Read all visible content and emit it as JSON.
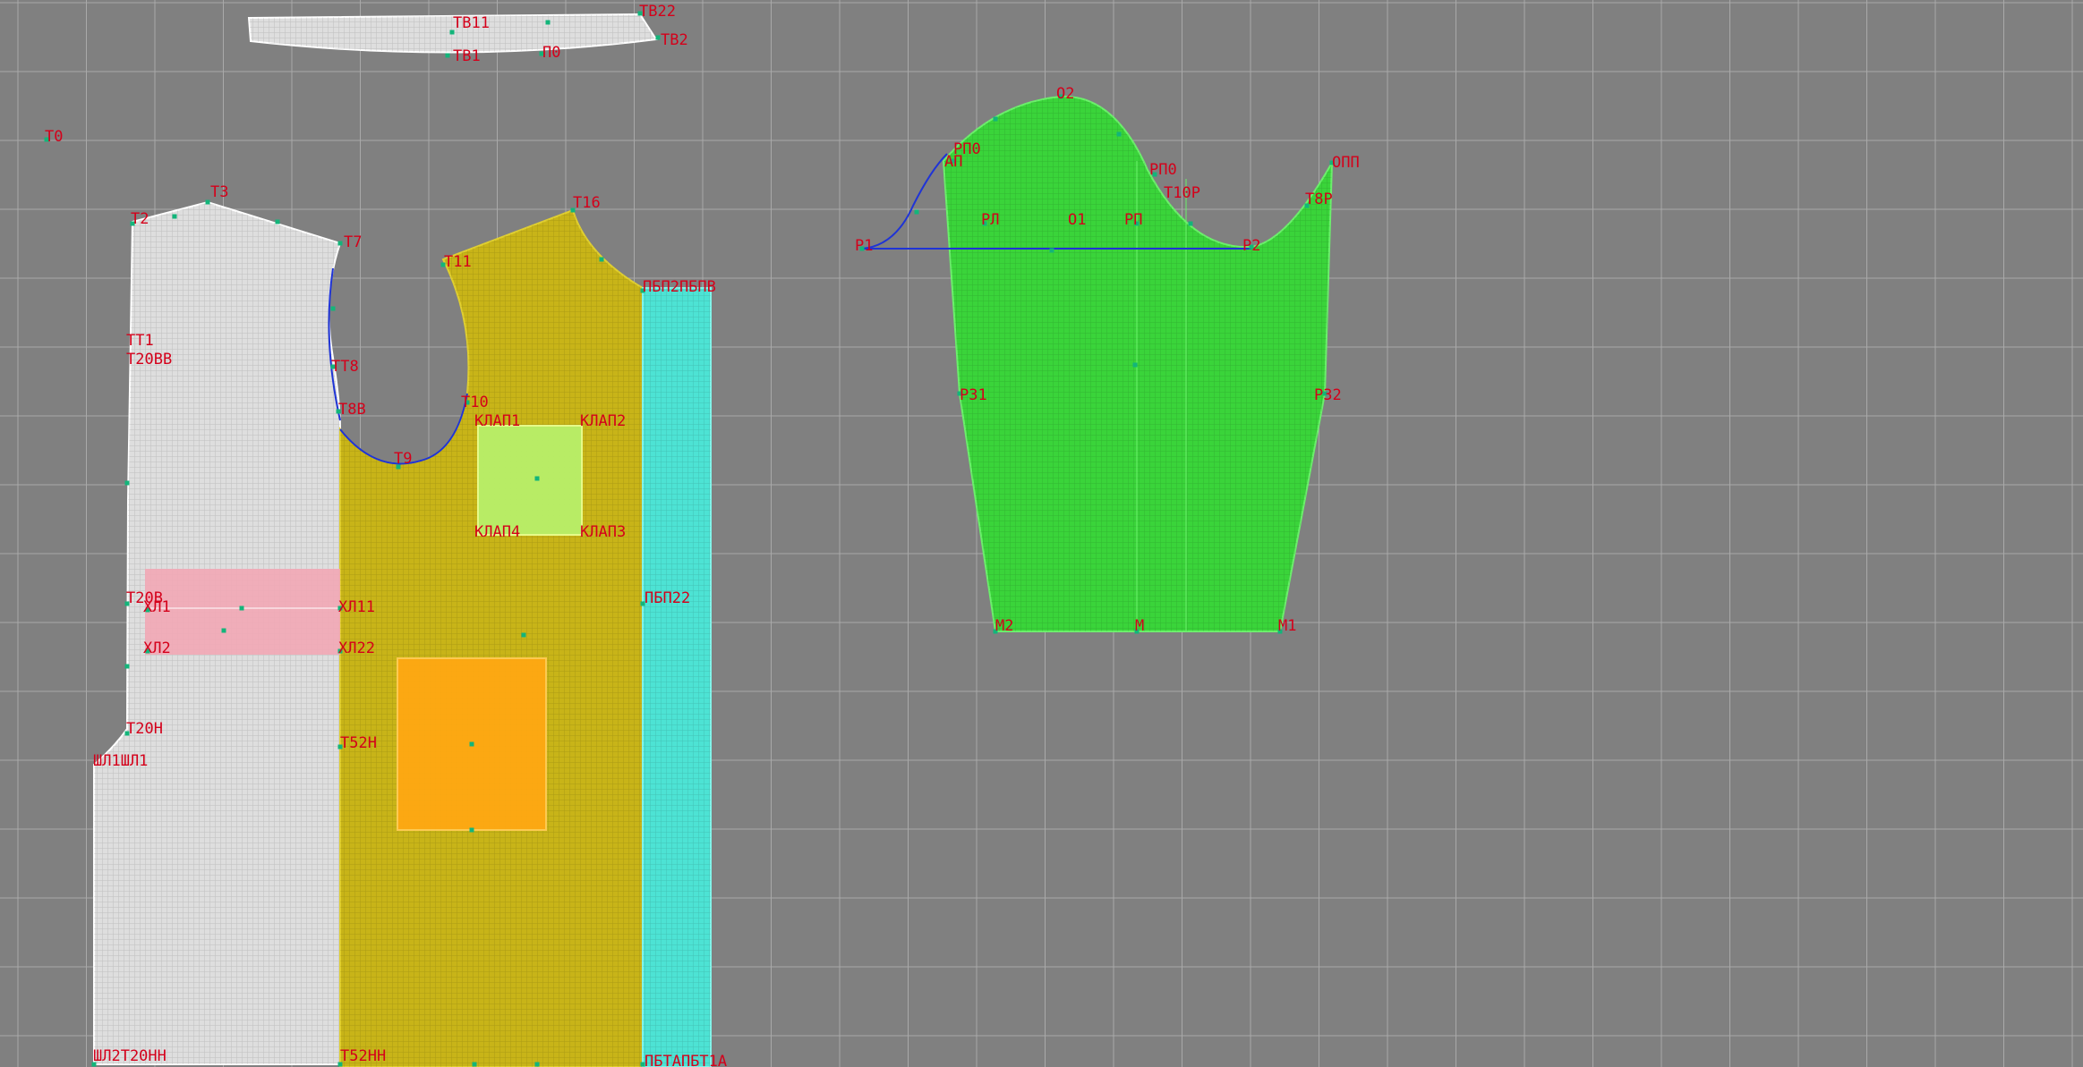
{
  "colors": {
    "background": "#808080",
    "grid": "#a9a9a9",
    "back_piece": "#dedede",
    "front_piece": "#c8b418",
    "placket": "#4de3d4",
    "sleeve": "#3ad43a",
    "pocket_flap": "#b8f06a",
    "pocket": "#ffa812",
    "pink_band": "#f2a7b5",
    "label": "#d4001a",
    "point": "#13b57a",
    "construction_line": "#1f34d6"
  },
  "labels": {
    "t0": "T0",
    "tb11": "TB11",
    "tb22": "TB22",
    "tb1": "TB1",
    "p0": "П0",
    "tb2": "TB2",
    "t3": "T3",
    "t2": "T2",
    "t7": "T7",
    "t11": "T11",
    "t16": "T16",
    "tt1": "TT1",
    "t20bb": "T20BB",
    "tt8": "TT8",
    "t8b": "T8B",
    "t10": "T10",
    "t9": "T9",
    "klap1": "КЛАП1",
    "klap2": "КЛАП2",
    "klap4": "КЛАП4",
    "klap3": "КЛАП3",
    "t20b": "T20B",
    "xl1": "ХЛ1",
    "xl11": "ХЛ11",
    "xl2": "ХЛ2",
    "xl22": "ХЛ22",
    "t20n": "T20H",
    "shl1": "ШЛ1ШЛ1",
    "t52n": "T52H",
    "shl2": "ШЛ2T20HH",
    "t52nn": "T52HH",
    "pbp22": "ПБП22",
    "pbp_top": "ПБП2ПБПВ",
    "pbp_bottom": "ПБТАПБТ1А",
    "rpo": "РП0",
    "ap": "АП",
    "o2": "O2",
    "rp0": "РП0",
    "t10r": "T10P",
    "opp": "ОПП",
    "t8r": "T8P",
    "r1": "P1",
    "rl": "РЛ",
    "o1": "O1",
    "rp": "РП",
    "r2": "P2",
    "r31": "P31",
    "r32": "P32",
    "m2": "M2",
    "m": "M",
    "m1": "M1"
  }
}
